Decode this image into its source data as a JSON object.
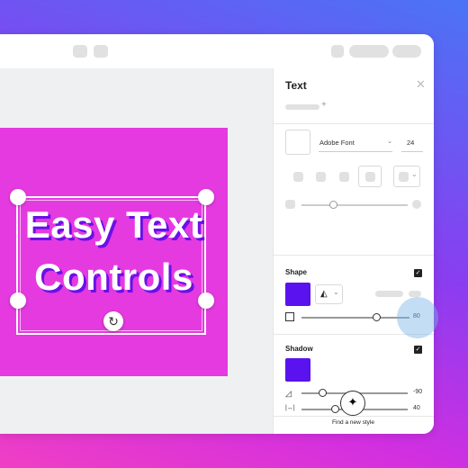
{
  "canvas": {
    "headline_line1": "Easy Text",
    "headline_line2": "Controls",
    "rotate_icon": "rotate-icon"
  },
  "panel": {
    "title": "Text",
    "close_icon": "close-icon",
    "font_name": "Adobe Font",
    "font_size": "24",
    "shape_label": "Shape",
    "shape_value": "80",
    "shadow_label": "Shadow",
    "shadow_angle_value": "-90",
    "shadow_spacing_value": "40",
    "find_style_label": "Find a new style",
    "spacing_icon_glyph": "|↔|"
  },
  "colors": {
    "artboard": "#e43ae0",
    "swatch": "#5a12ee",
    "text_shadow": "#6a10e8"
  }
}
